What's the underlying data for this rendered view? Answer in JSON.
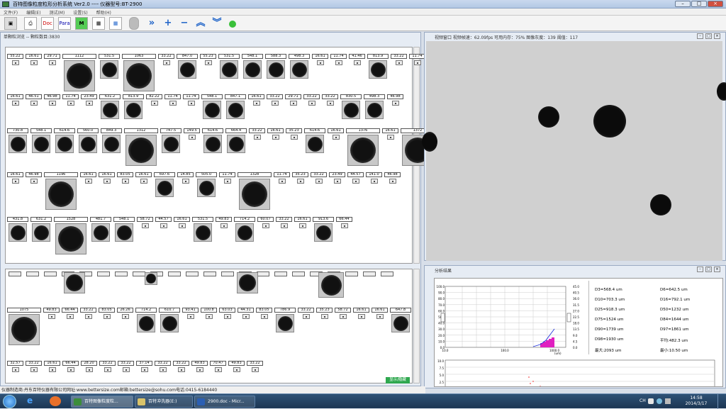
{
  "window": {
    "title": "百特图像粒度粒形分析系统 Ver2.0 ---- 仪器型号:BT-2900"
  },
  "menu": [
    "文件(F)",
    "编辑(E)",
    "测试(M)",
    "设置(S)",
    "帮助(H)"
  ],
  "toolbar": {
    "doc_label": "Doc",
    "para_label": "Para",
    "m_label": "M"
  },
  "left": {
    "caption": "单颗粒浏览 -- 颗粒数目:3830",
    "button": "显示/隐藏"
  },
  "right": {
    "caption": "视频窗口  视频帧速：62.09fps  可用内存：75%  图像灰度：139  阈值：117"
  },
  "result": {
    "caption": "分析结果",
    "chart_left_ticks": [
      "100.0",
      "90.0",
      "80.0",
      "70.0",
      "60.0",
      "50.0",
      "40.0",
      "30.0",
      "20.0",
      "10.0",
      "0.0"
    ],
    "chart_right_ticks": [
      "45.0",
      "40.5",
      "36.0",
      "31.5",
      "27.0",
      "22.5",
      "18.0",
      "13.5",
      "9.0",
      "4.5",
      "0.0"
    ],
    "chart_x_ticks": [
      "10.0",
      "100.0",
      "1000.0"
    ],
    "chart_x_unit": "(um)",
    "chart2_ticks": [
      "10.0",
      "7.5",
      "5.0",
      "2.5"
    ],
    "stats": [
      [
        "D3=568.4 um",
        "D6=642.5 um"
      ],
      [
        "D10=703.3 um",
        "D16=792.1 um"
      ],
      [
        "D25=918.3 um",
        "D50=1232 um"
      ],
      [
        "D75=1524 um",
        "D84=1644 um"
      ],
      [
        "D90=1739 um",
        "D97=1861 um"
      ],
      [
        "D98=1930 um",
        "平均:482.3 um"
      ],
      [
        "最大:2093 um",
        "最小:10.50 um"
      ]
    ]
  },
  "statusbar": "仪器制造商:丹东百特仪器有限公司网址:www.bettersize.com邮箱:bettersize@sohu.com电话:0415-6184440",
  "taskbar": {
    "tasks": [
      "百特图像粒度粒...",
      "百特冲洗器(E:)",
      "2900.doc - Micr..."
    ],
    "ime": "CH",
    "time": "14:58",
    "date": "2014/3/17"
  },
  "grid": {
    "row1": [
      "55.22",
      "16.61",
      "29.71",
      "1112",
      "531.5",
      "1063",
      "33.22",
      "847.0",
      "55.23",
      "531.5",
      "548.1",
      "588.3",
      "498.3",
      "16.61",
      "11.74",
      "41.46",
      "813.9",
      "33.22",
      "11.74"
    ],
    "row2": [
      "16.61",
      "46.51",
      "46.98",
      "11.74",
      "23.49",
      "631.2",
      "813.9",
      "82.22",
      "11.74",
      "11.74",
      "548.1",
      "847.1",
      "16.61",
      "33.22",
      "29.71",
      "33.22",
      "33.22",
      "830.5",
      "498.3",
      "46.98"
    ],
    "row3": [
      "730.8",
      "548.1",
      "614.6",
      "560.0",
      "849.3",
      "1312",
      "747.5",
      "149.5",
      "614.6",
      "664.4",
      "33.22",
      "16.61",
      "35.23",
      "614.6",
      "16.61",
      "1376",
      "16.61",
      "1372"
    ],
    "row4": [
      "16.61",
      "46.98",
      "1196",
      "16.61",
      "16.61",
      "83.05",
      "16.61",
      "697.6",
      "14.85",
      "505.0",
      "11.74",
      "1328",
      "11.74",
      "35.23",
      "33.22",
      "23.49",
      "44.57",
      "141.0",
      "46.98"
    ],
    "row5": [
      "431.8",
      "631.2",
      "1528",
      "481.7",
      "548.1",
      "58.72",
      "44.57",
      "16.61",
      "531.5",
      "49.83",
      "714.2",
      "60.07",
      "33.22",
      "16.61",
      "913.6",
      "66.44"
    ],
    "row7": [
      "1075",
      "49.83",
      "66.44",
      "33.22",
      "83.05",
      "26.26",
      "714.2",
      "610.7",
      "93.41",
      "100.8",
      "63.03",
      "44.31",
      "83.05",
      "786.9",
      "33.22",
      "35.23",
      "58.72",
      "16.61",
      "16.61",
      "647.8"
    ],
    "row8": [
      "32.57",
      "33.22",
      "16.61",
      "66.44",
      "28.20",
      "33.22",
      "33.22",
      "37.14",
      "33.22",
      "33.22",
      "49.83",
      "70.47",
      "49.83",
      "33.22"
    ]
  }
}
